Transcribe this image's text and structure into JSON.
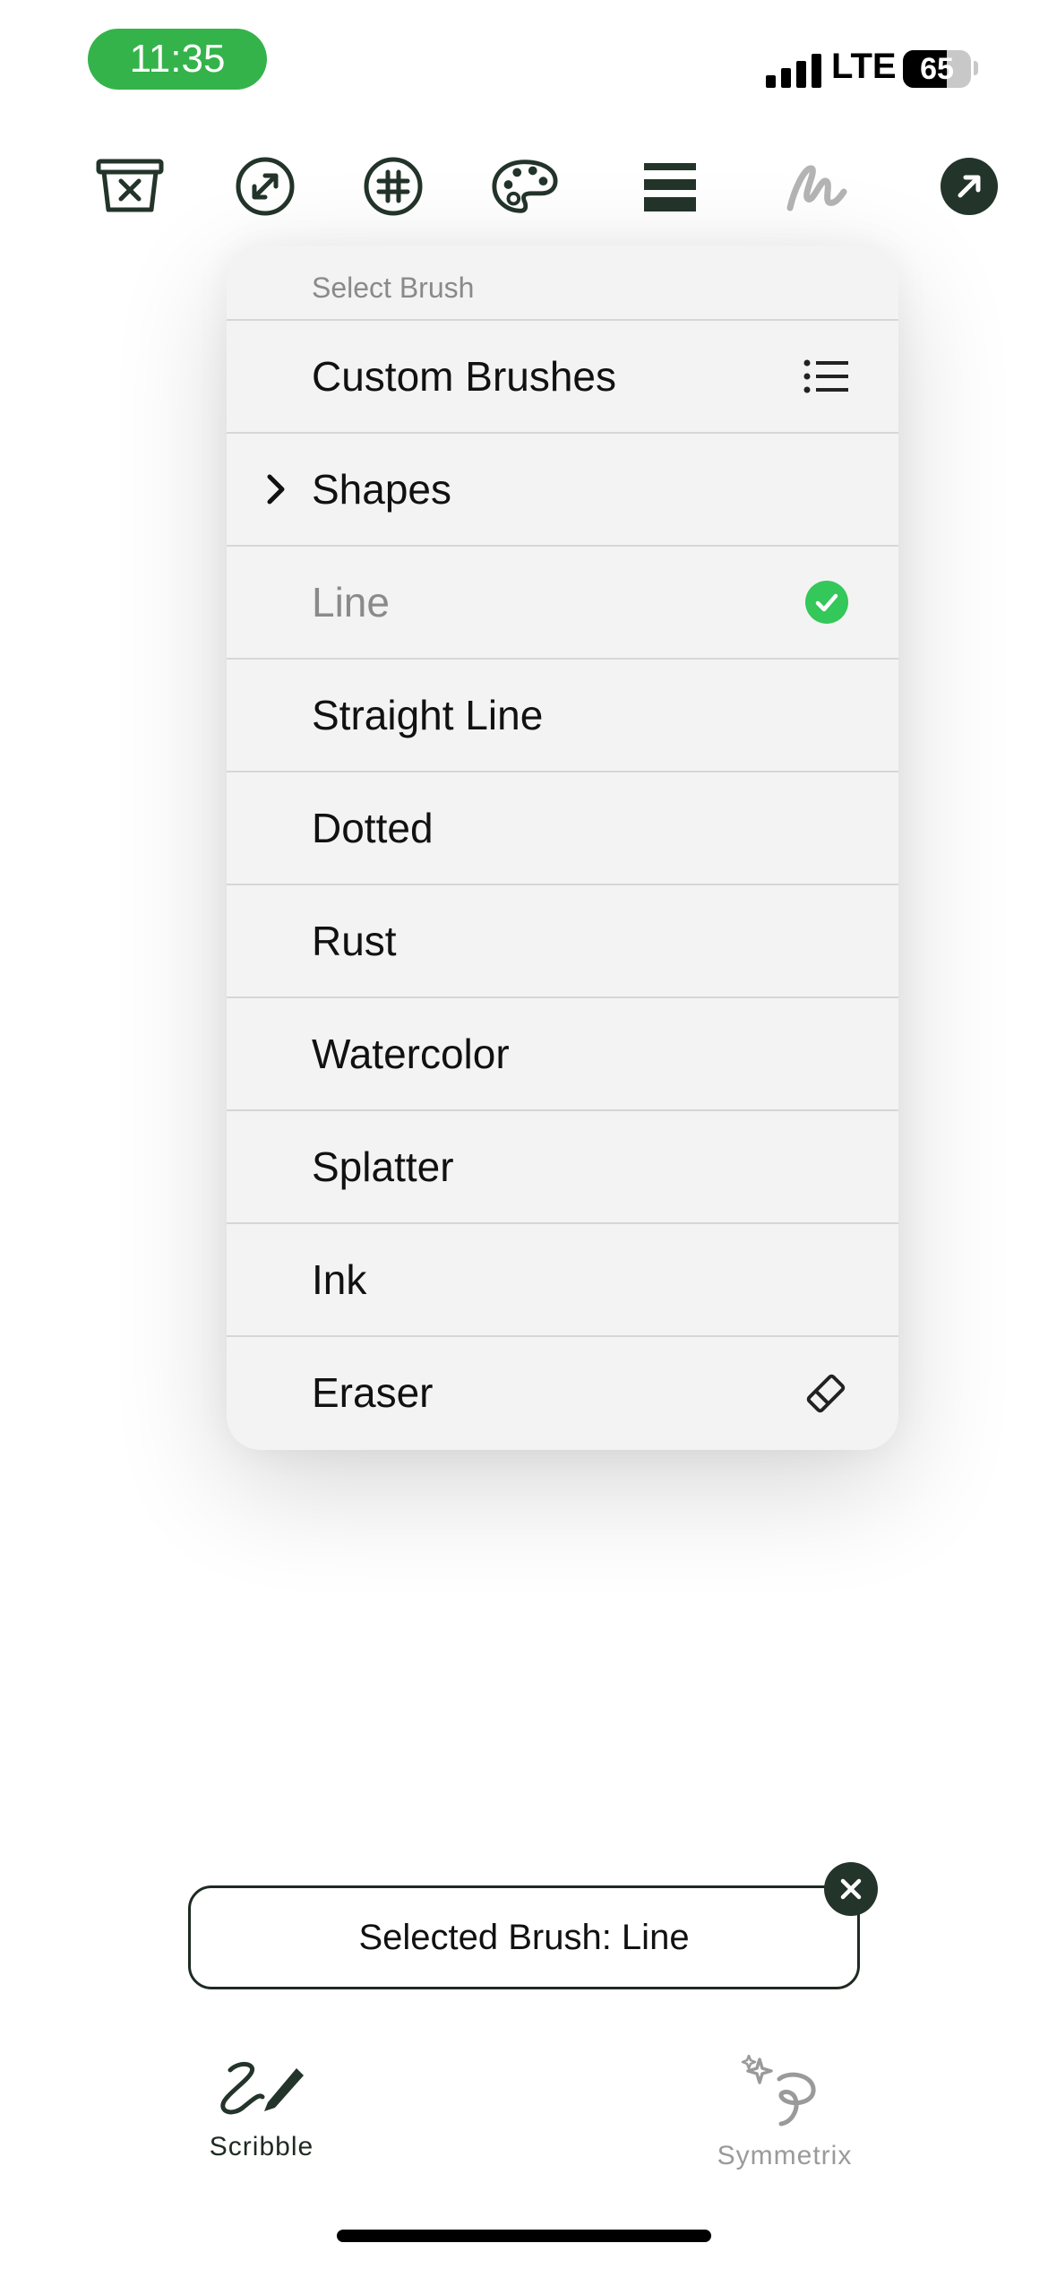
{
  "status_bar": {
    "time": "11:35",
    "network": "LTE",
    "battery": "65",
    "battery_fraction": 0.65
  },
  "toolbar": {
    "icons": [
      "clear-canvas-icon",
      "resize-arrows-icon",
      "grid-icon",
      "palette-icon",
      "stroke-width-icon",
      "brush-icon",
      "share-icon"
    ]
  },
  "brush_menu": {
    "title": "Select Brush",
    "items": [
      {
        "label": "Custom Brushes",
        "icon": "list-icon"
      },
      {
        "label": "Shapes",
        "icon": "chevron-right-icon"
      },
      {
        "label": "Line",
        "icon": "checkmark-icon",
        "selected": true
      },
      {
        "label": "Straight Line"
      },
      {
        "label": "Dotted"
      },
      {
        "label": "Rust"
      },
      {
        "label": "Watercolor"
      },
      {
        "label": "Splatter"
      },
      {
        "label": "Ink"
      },
      {
        "label": "Eraser",
        "icon": "eraser-icon"
      }
    ]
  },
  "toast": {
    "text": "Selected Brush: Line"
  },
  "tabs": [
    {
      "label": "Scribble",
      "active": true
    },
    {
      "label": "Symmetrix",
      "active": false
    }
  ],
  "colors": {
    "accent_green": "#34b34a",
    "dark_green": "#23342a",
    "check_green": "#34c759"
  }
}
